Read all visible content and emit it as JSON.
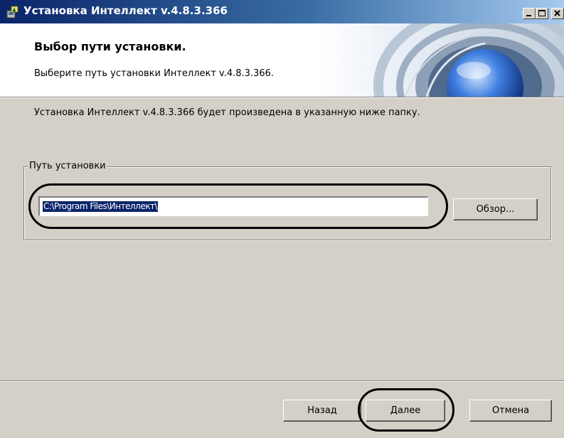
{
  "window": {
    "title": "Установка Интеллект v.4.8.3.366",
    "icon": "installer-icon",
    "controls": [
      "minimize-icon",
      "maximize-icon",
      "close-icon"
    ]
  },
  "header": {
    "title": "Выбор пути установки.",
    "subtitle": "Выберите путь установки Интеллект v.4.8.3.366."
  },
  "main": {
    "description": "Установка Интеллект v.4.8.3.366 будет произведена в указанную ниже папку.",
    "group_label": "Путь установки",
    "path_value": "C:\\Program Files\\Интеллект\\",
    "browse_label": "Обзор..."
  },
  "footer": {
    "back_label": "Назад",
    "next_label": "Далее",
    "cancel_label": "Отмена"
  },
  "colors": {
    "titlebar_start": "#0a246a",
    "titlebar_end": "#a6caf0",
    "face": "#d4d0c8",
    "selection": "#0a246a"
  }
}
